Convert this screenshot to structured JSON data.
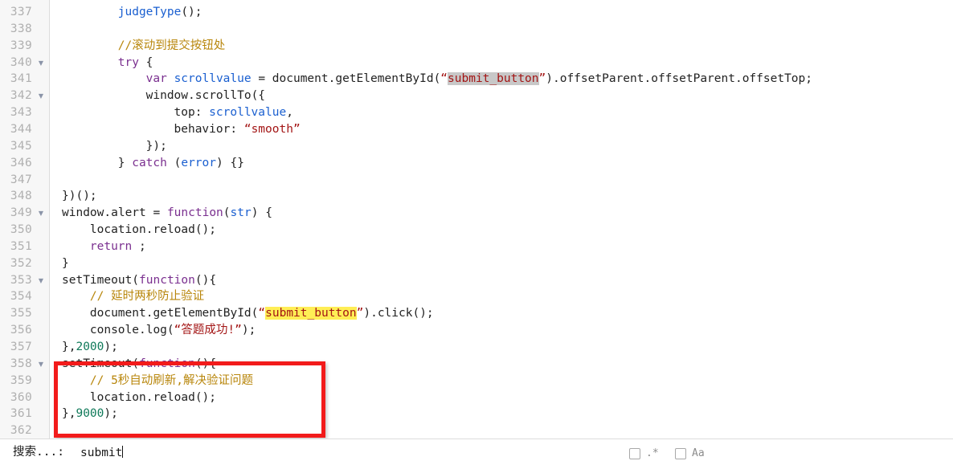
{
  "editor": {
    "first_line_number": 337,
    "gutter_color": "#f7f7f7",
    "colors": {
      "keyword": "#7a2f8f",
      "identifier": "#1a5fd0",
      "string": "#a31515",
      "comment": "#b8860b",
      "number": "#107a5a",
      "plain": "#222222",
      "current_match_highlight": "#ffee55",
      "other_match_highlight": "#c8c8c8",
      "annotation_box": "#f21b1b"
    },
    "lines": [
      {
        "n": "337",
        "fold": false,
        "text": "        judgeType();"
      },
      {
        "n": "338",
        "fold": false,
        "text": ""
      },
      {
        "n": "339",
        "fold": false,
        "text": "        //滚动到提交按钮处"
      },
      {
        "n": "340",
        "fold": true,
        "text": "        try {"
      },
      {
        "n": "341",
        "fold": false,
        "text": "            var scrollvalue = document.getElementById(\"submit_button\").offsetParent.offsetParent.offsetTop;"
      },
      {
        "n": "342",
        "fold": true,
        "text": "            window.scrollTo({"
      },
      {
        "n": "343",
        "fold": false,
        "text": "                top: scrollvalue,"
      },
      {
        "n": "344",
        "fold": false,
        "text": "                behavior: \"smooth\""
      },
      {
        "n": "345",
        "fold": false,
        "text": "            });"
      },
      {
        "n": "346",
        "fold": false,
        "text": "        } catch (error) {}"
      },
      {
        "n": "347",
        "fold": false,
        "text": ""
      },
      {
        "n": "348",
        "fold": false,
        "text": "})();"
      },
      {
        "n": "349",
        "fold": true,
        "text": "window.alert = function(str) {"
      },
      {
        "n": "350",
        "fold": false,
        "text": "    location.reload();"
      },
      {
        "n": "351",
        "fold": false,
        "text": "    return ;"
      },
      {
        "n": "352",
        "fold": false,
        "text": "}"
      },
      {
        "n": "353",
        "fold": true,
        "text": "setTimeout(function(){"
      },
      {
        "n": "354",
        "fold": false,
        "text": "    // 延时两秒防止验证"
      },
      {
        "n": "355",
        "fold": false,
        "text": "    document.getElementById(\"submit_button\").click();"
      },
      {
        "n": "356",
        "fold": false,
        "text": "    console.log(\"答题成功!\");"
      },
      {
        "n": "357",
        "fold": false,
        "text": "},2000);"
      },
      {
        "n": "358",
        "fold": true,
        "text": "setTimeout(function(){"
      },
      {
        "n": "359",
        "fold": false,
        "text": "    // 5秒自动刷新,解决验证问题"
      },
      {
        "n": "360",
        "fold": false,
        "text": "    location.reload();"
      },
      {
        "n": "361",
        "fold": false,
        "text": "},9000);"
      },
      {
        "n": "362",
        "fold": false,
        "text": ""
      }
    ],
    "tokens": {
      "l337": {
        "fn": "judgeType",
        "tail": "();"
      },
      "l339": {
        "comment": "//滚动到提交按钮处"
      },
      "l340": {
        "kw": "try",
        "tail": " {"
      },
      "l341": {
        "kw": "var",
        "ident": "scrollvalue",
        "mid": " = document.getElementById(",
        "quote_open": "“",
        "match": "submit_button",
        "quote_close": "”",
        "tail": ").offsetParent.offsetParent.offsetTop;"
      },
      "l342": {
        "text": "window.scrollTo({"
      },
      "l343": {
        "prop": "top: ",
        "ident": "scrollvalue",
        "tail": ","
      },
      "l344": {
        "prop": "behavior: ",
        "quote_open": "“",
        "str": "smooth",
        "quote_close": "”"
      },
      "l345": {
        "text": "});"
      },
      "l346": {
        "brace": "} ",
        "kw": "catch",
        "mid": " (",
        "ident": "error",
        "tail": ") {}"
      },
      "l348": {
        "text": "})();"
      },
      "l349": {
        "head": "window.alert = ",
        "kw": "function",
        "p1": "(",
        "ident": "str",
        "p2": ") {"
      },
      "l350": {
        "text": "location.reload();"
      },
      "l351": {
        "kw": "return",
        "tail": " ;"
      },
      "l352": {
        "text": "}"
      },
      "l353": {
        "head": "setTimeout(",
        "kw": "function",
        "tail": "(){"
      },
      "l354": {
        "comment": "// 延时两秒防止验证"
      },
      "l355": {
        "head": "document.getElementById(",
        "quote_open": "“",
        "match": "submit_button",
        "quote_close": "”",
        "tail": ").click();"
      },
      "l356": {
        "head": "console.log(",
        "quote_open": "“",
        "str": "答题成功!",
        "quote_close": "”",
        "tail": ");"
      },
      "l357": {
        "head": "},",
        "num": "2000",
        "tail": ");"
      },
      "l358": {
        "head": "setTimeout(",
        "kw": "function",
        "tail": "(){"
      },
      "l359": {
        "comment": "// 5秒自动刷新,解决验证问题"
      },
      "l360": {
        "text": "location.reload();"
      },
      "l361": {
        "head": "},",
        "num": "9000",
        "tail": ");"
      }
    }
  },
  "annotation": {
    "shape": "rectangle",
    "color": "#f21b1b",
    "covers_lines": "358-361"
  },
  "search": {
    "label": "搜索...:",
    "value": "submit",
    "placeholder": "",
    "options": [
      {
        "name": "regex",
        "label": ".*",
        "checked": false
      },
      {
        "name": "case-sensitive",
        "label": "Aa",
        "checked": false
      }
    ]
  }
}
